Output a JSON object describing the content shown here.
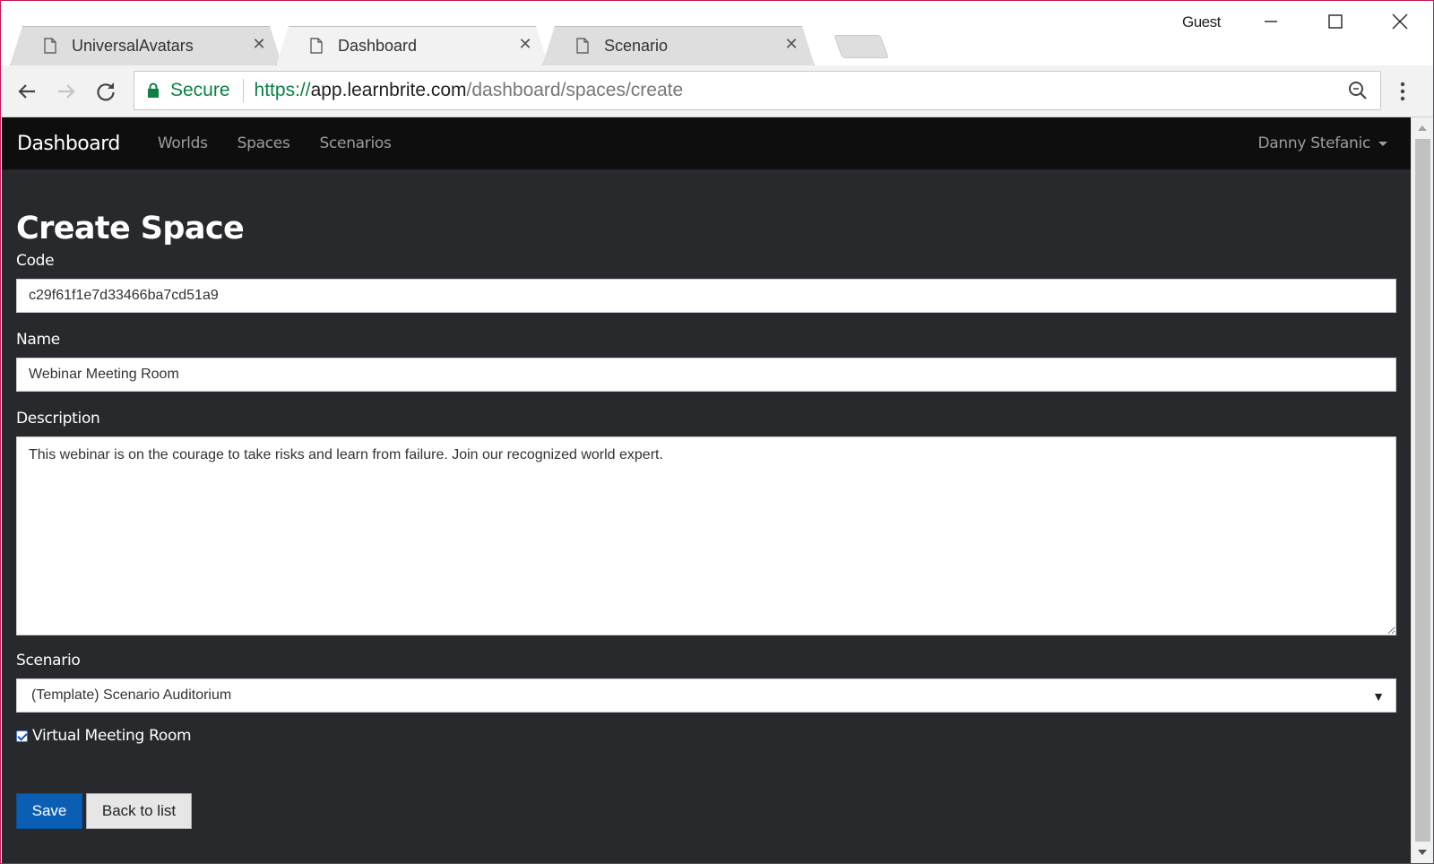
{
  "browser": {
    "tabs": [
      {
        "title": "UniversalAvatars",
        "active": false
      },
      {
        "title": "Dashboard",
        "active": true
      },
      {
        "title": "Scenario",
        "active": false
      }
    ],
    "profile": "Guest",
    "address": {
      "secure_label": "Secure",
      "scheme": "https://",
      "host": "app.learnbrite.com",
      "path": "/dashboard/spaces/create"
    }
  },
  "nav": {
    "brand": "Dashboard",
    "links": [
      "Worlds",
      "Spaces",
      "Scenarios"
    ],
    "user": "Danny Stefanic"
  },
  "form": {
    "title": "Create Space",
    "code_label": "Code",
    "code_value": "c29f61f1e7d33466ba7cd51a9",
    "name_label": "Name",
    "name_value": "Webinar Meeting Room",
    "description_label": "Description",
    "description_value": "This webinar is on the courage to take risks and learn from failure. Join our recognized world expert.",
    "scenario_label": "Scenario",
    "scenario_value": "(Template) Scenario Auditorium",
    "virtual_room_label": "Virtual Meeting Room",
    "virtual_room_checked": true,
    "save_label": "Save",
    "back_label": "Back to list"
  },
  "colors": {
    "page_bg": "#28292c",
    "navbar_bg": "#0e0e0e",
    "primary_button": "#0a5fb4",
    "secure_green": "#0b8043",
    "window_border": "#c2185b"
  }
}
